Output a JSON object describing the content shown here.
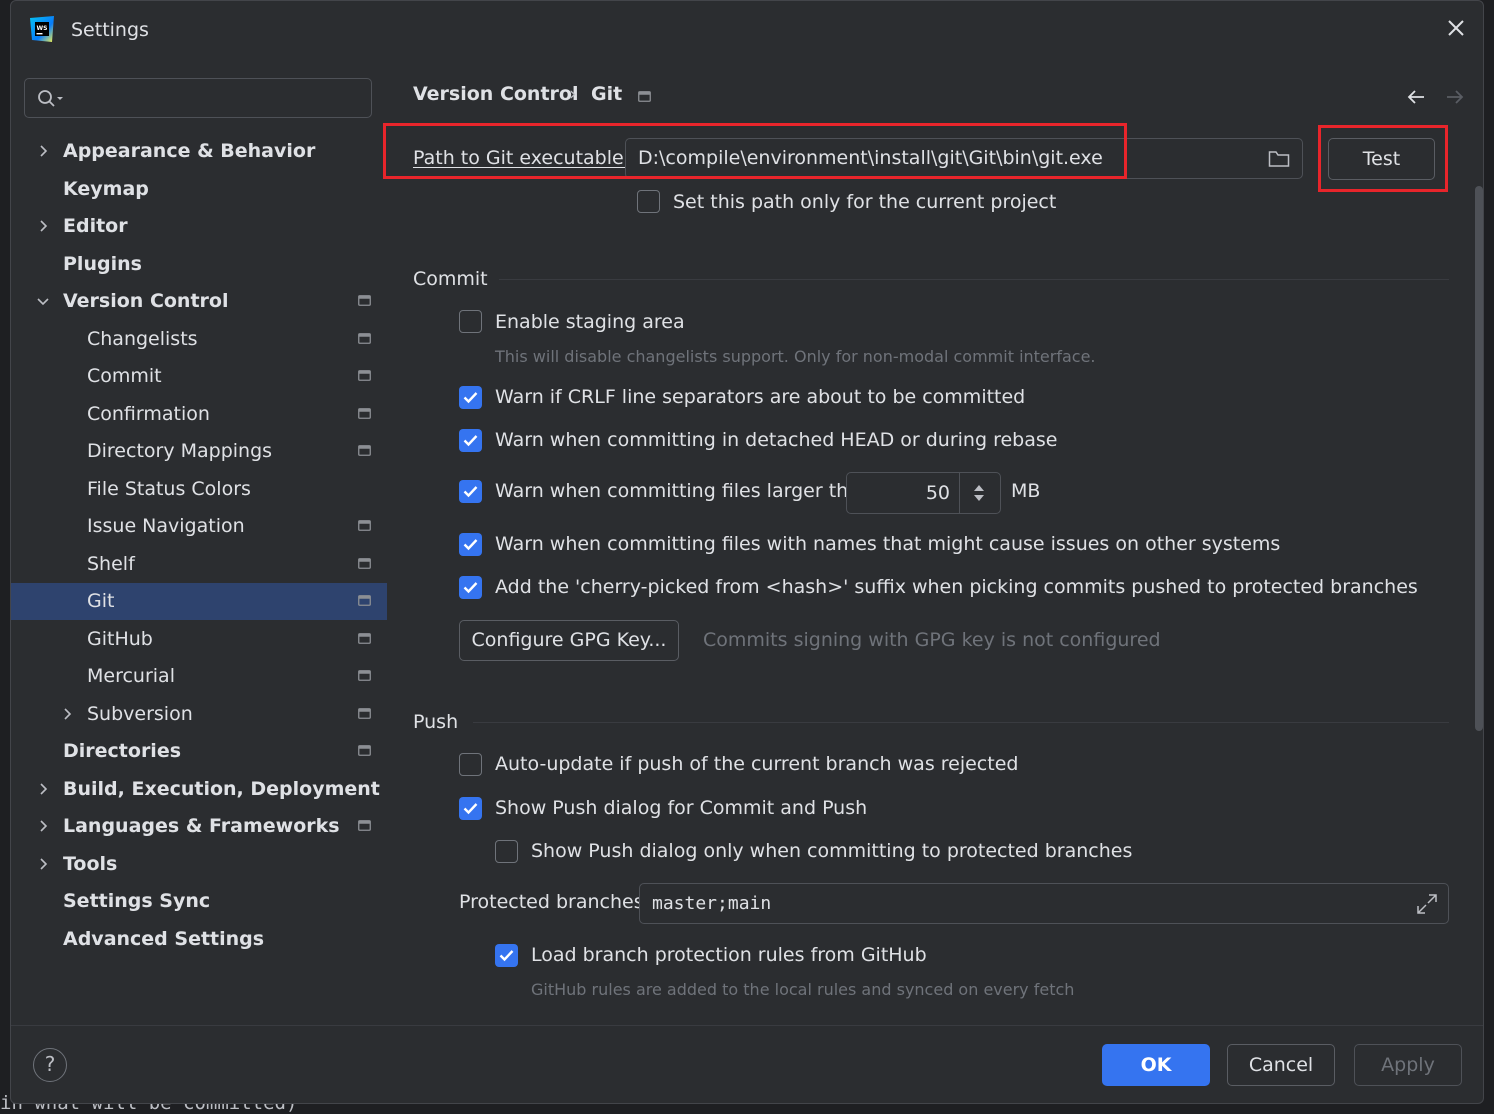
{
  "window": {
    "title": "Settings"
  },
  "background_text": {
    "bottom_code": "in what will be committed)"
  },
  "sidebar": {
    "search_placeholder": "",
    "items": [
      {
        "label": "Appearance & Behavior"
      },
      {
        "label": "Keymap"
      },
      {
        "label": "Editor"
      },
      {
        "label": "Plugins"
      },
      {
        "label": "Version Control"
      },
      {
        "label": "Changelists"
      },
      {
        "label": "Commit"
      },
      {
        "label": "Confirmation"
      },
      {
        "label": "Directory Mappings"
      },
      {
        "label": "File Status Colors"
      },
      {
        "label": "Issue Navigation"
      },
      {
        "label": "Shelf"
      },
      {
        "label": "Git"
      },
      {
        "label": "GitHub"
      },
      {
        "label": "Mercurial"
      },
      {
        "label": "Subversion"
      },
      {
        "label": "Directories"
      },
      {
        "label": "Build, Execution, Deployment"
      },
      {
        "label": "Languages & Frameworks"
      },
      {
        "label": "Tools"
      },
      {
        "label": "Settings Sync"
      },
      {
        "label": "Advanced Settings"
      }
    ],
    "selected": "Git"
  },
  "breadcrumb": {
    "parent": "Version Control",
    "separator": "›",
    "current": "Git"
  },
  "git_path": {
    "label": "Path to Git executable:",
    "value": "D:\\compile\\environment\\install\\git\\Git\\bin\\git.exe",
    "test_label": "Test",
    "current_project_label": "Set this path only for the current project",
    "current_project_checked": false
  },
  "commit": {
    "section": "Commit",
    "staging_label": "Enable staging area",
    "staging_checked": false,
    "staging_hint": "This will disable changelists support. Only for non-modal commit interface.",
    "crlf_label": "Warn if CRLF line separators are about to be committed",
    "crlf_checked": true,
    "detached_label": "Warn when committing in detached HEAD or during rebase",
    "detached_checked": true,
    "large_label": "Warn when committing files larger than",
    "large_checked": true,
    "large_value": "50",
    "large_unit": "MB",
    "names_label": "Warn when committing files with names that might cause issues on other systems",
    "names_checked": true,
    "cherry_label": "Add the 'cherry-picked from <hash>' suffix when picking commits pushed to protected branches",
    "cherry_checked": true,
    "gpg_button": "Configure GPG Key...",
    "gpg_status": "Commits signing with GPG key is not configured"
  },
  "push": {
    "section": "Push",
    "autoupdate_label": "Auto-update if push of the current branch was rejected",
    "autoupdate_checked": false,
    "show_dialog_label": "Show Push dialog for Commit and Push",
    "show_dialog_checked": true,
    "protected_only_label": "Show Push dialog only when committing to protected branches",
    "protected_only_checked": false,
    "protected_label": "Protected branches:",
    "protected_value": "master;main",
    "github_rules_label": "Load branch protection rules from GitHub",
    "github_rules_checked": true,
    "github_rules_hint": "GitHub rules are added to the local rules and synced on every fetch"
  },
  "footer": {
    "help": "?",
    "ok": "OK",
    "cancel": "Cancel",
    "apply": "Apply"
  },
  "colors": {
    "accent": "#3574f0",
    "selection": "#2e436e",
    "highlight_box": "#e8252b",
    "background": "#2b2d30"
  },
  "icons": [
    "webstorm-app-icon",
    "close-icon",
    "search-icon",
    "chevron-right-icon",
    "chevron-down-icon",
    "project-scope-icon",
    "back-arrow-icon",
    "forward-arrow-icon",
    "folder-icon",
    "spinner-arrows-icon",
    "expand-icon",
    "checkmark-icon",
    "help-icon"
  ]
}
